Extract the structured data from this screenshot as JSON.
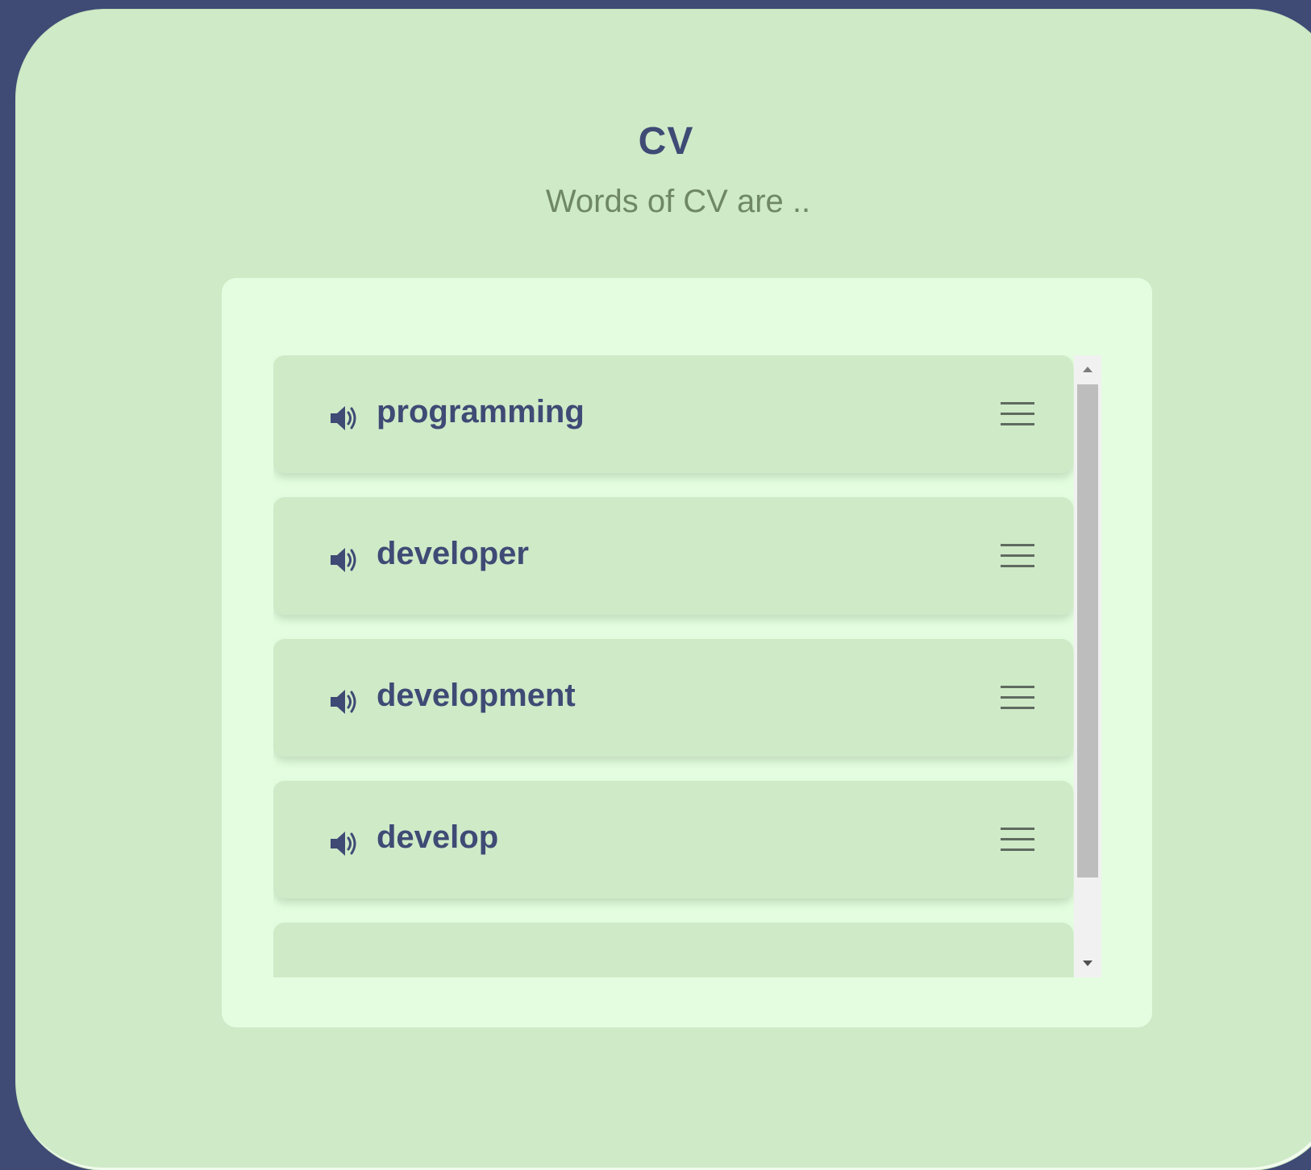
{
  "header": {
    "title": "CV",
    "subtitle": "Words of CV are .."
  },
  "words": [
    {
      "label": "programming"
    },
    {
      "label": "developer"
    },
    {
      "label": "development"
    },
    {
      "label": "develop"
    },
    {
      "label": ""
    }
  ],
  "icons": {
    "speaker": "speaker-icon",
    "drag": "hamburger-menu-icon"
  },
  "colors": {
    "background": "#3f4a75",
    "card": "#ceeac7",
    "panel": "#e4fde0",
    "text_primary": "#3f4a75",
    "text_secondary": "#6f8765"
  },
  "scrollbar": {
    "position_fraction": 0.0
  }
}
